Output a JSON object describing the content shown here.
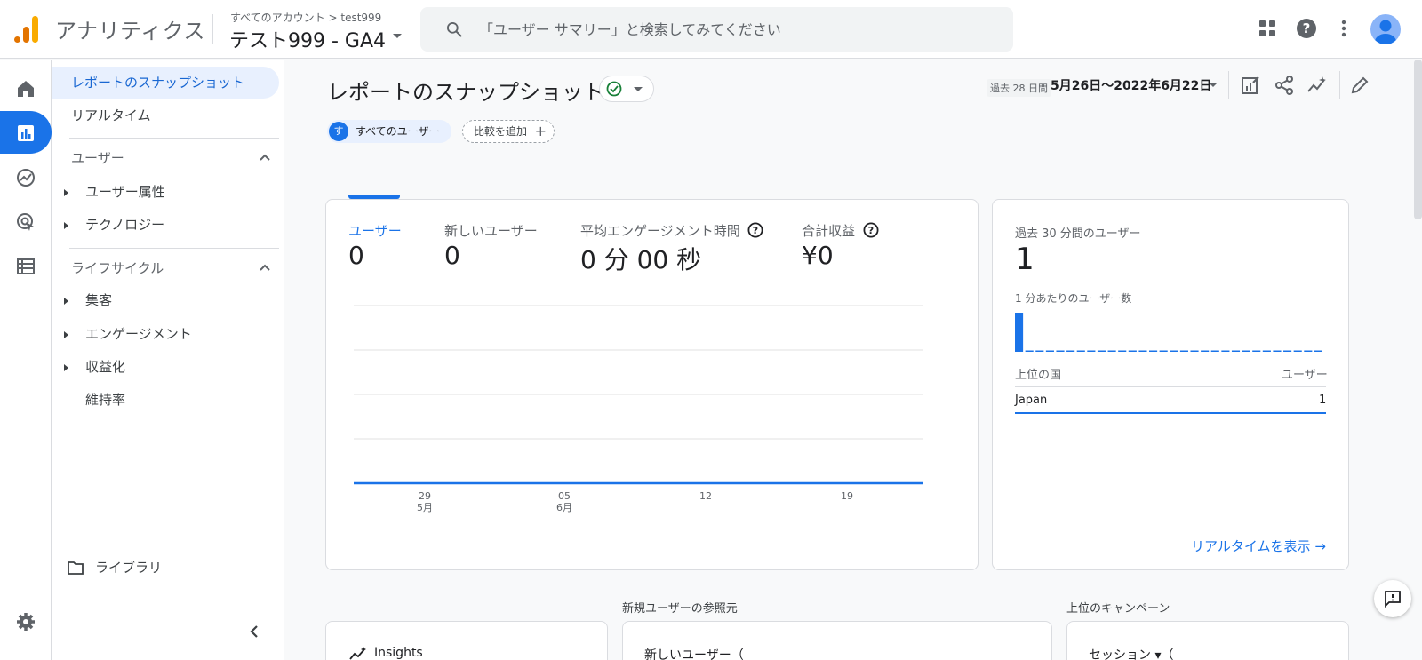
{
  "header": {
    "app_name": "アナリティクス",
    "account_crumb": "すべてのアカウント > test999",
    "property_name": "テスト999 - GA4",
    "search_placeholder": "「ユーザー サマリー」と検索してみてください",
    "icons": [
      "apps-grid-icon",
      "help-icon",
      "more-vert-icon",
      "account-avatar"
    ]
  },
  "rail": {
    "items": [
      "home-icon",
      "reports-icon",
      "explore-icon",
      "advertising-icon",
      "configure-icon"
    ],
    "active": "reports-icon",
    "bottom": "settings-icon"
  },
  "nav": {
    "items": [
      {
        "label": "レポートのスナップショット",
        "active": true
      },
      {
        "label": "リアルタイム"
      }
    ],
    "sections": [
      {
        "label": "ユーザー",
        "children": [
          "ユーザー属性",
          "テクノロジー"
        ]
      },
      {
        "label": "ライフサイクル",
        "children": [
          "集客",
          "エンゲージメント",
          "収益化"
        ],
        "extra": "維持率"
      }
    ],
    "library": "ライブラリ"
  },
  "main": {
    "title": "レポートのスナップショット",
    "date_prefix": "過去 28 日間",
    "date_range": "5月26日～2022年6月22日",
    "chips": {
      "user_avatar": "す",
      "user": "すべてのユーザー",
      "compare": "比較を追加",
      "compare_plus": "+"
    },
    "metrics": [
      {
        "label": "ユーザー",
        "value": "0"
      },
      {
        "label": "新しいユーザー",
        "value": "0"
      },
      {
        "label": "平均エンゲージメント時間",
        "value": "0 分 00 秒"
      },
      {
        "label": "合計収益",
        "value": "¥0"
      }
    ],
    "x_ticks": [
      {
        "day": "29",
        "month": "5月"
      },
      {
        "day": "05",
        "month": "6月"
      },
      {
        "day": "12",
        "month": ""
      },
      {
        "day": "19",
        "month": ""
      }
    ],
    "realtime": {
      "label": "過去 30 分間のユーザー",
      "value": "1",
      "per_minute": "1 分あたりのユーザー数",
      "col_country": "上位の国",
      "col_users": "ユーザー",
      "row_country": "Japan",
      "row_users": "1",
      "link": "リアルタイムを表示 →"
    },
    "sections": {
      "new_user_source": "新規ユーザーの参照元",
      "top_campaign": "上位のキャンペーン"
    },
    "bottom_cards": {
      "insights": "Insights",
      "new_users": "新しいユーザー（",
      "sessions": "セッション ▾（"
    }
  },
  "colors": {
    "accent": "#1a73e8",
    "logo_orange": "#e37400",
    "logo_yellow": "#f9ab00",
    "success": "#188038"
  },
  "chart_data": {
    "type": "line",
    "categories": [
      "5月29",
      "6月05",
      "6月12",
      "6月19"
    ],
    "series": [
      {
        "values": [
          0,
          0,
          0,
          0
        ]
      }
    ],
    "ylim": [
      0,
      4
    ]
  },
  "realtime_bars": [
    1,
    0,
    0,
    0,
    0,
    0,
    0,
    0,
    0,
    0,
    0,
    0,
    0,
    0,
    0,
    0,
    0,
    0,
    0,
    0,
    0,
    0,
    0,
    0,
    0,
    0,
    0,
    0,
    0,
    0
  ]
}
